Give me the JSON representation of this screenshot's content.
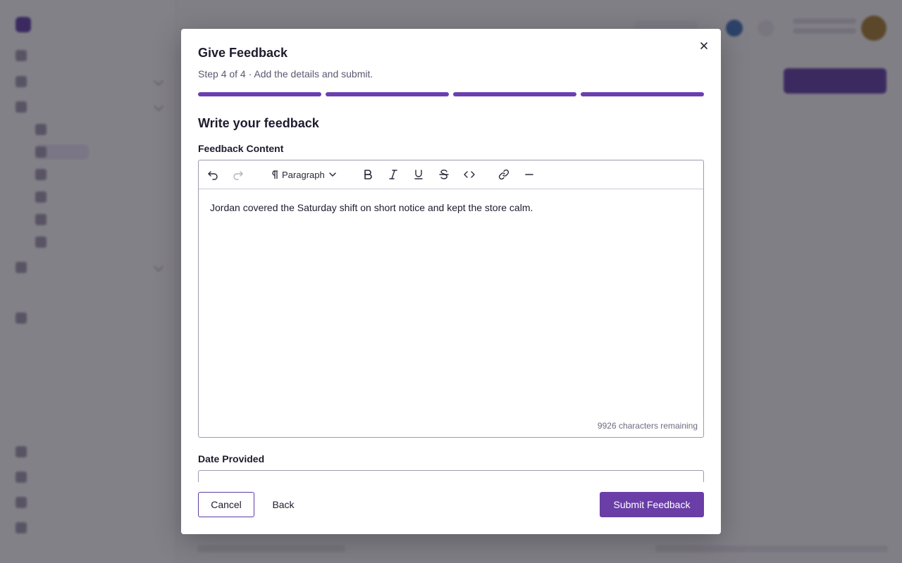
{
  "modal": {
    "title": "Give Feedback",
    "subtitle": "Step 4 of 4 · Add the details and submit.",
    "steps_total": 4,
    "steps_completed": 4,
    "accent": "#6a3ea6",
    "close_icon": "close-icon"
  },
  "section": {
    "title": "Write your feedback"
  },
  "editor": {
    "label": "Feedback Content",
    "toolbar": {
      "undo_icon": "undo-icon",
      "redo_icon": "redo-icon",
      "paragraph_label": "Paragraph",
      "buttons": [
        "bold-icon",
        "italic-icon",
        "underline-icon",
        "strikethrough-icon",
        "code-icon",
        "link-icon",
        "horizontal-rule-icon"
      ]
    },
    "content": "Jordan covered the Saturday shift on short notice and kept the store calm.",
    "chars_remaining": "9926 characters remaining"
  },
  "date_field": {
    "label": "Date Provided",
    "value": ""
  },
  "footer": {
    "cancel_label": "Cancel",
    "back_label": "Back",
    "submit_label": "Submit Feedback"
  }
}
